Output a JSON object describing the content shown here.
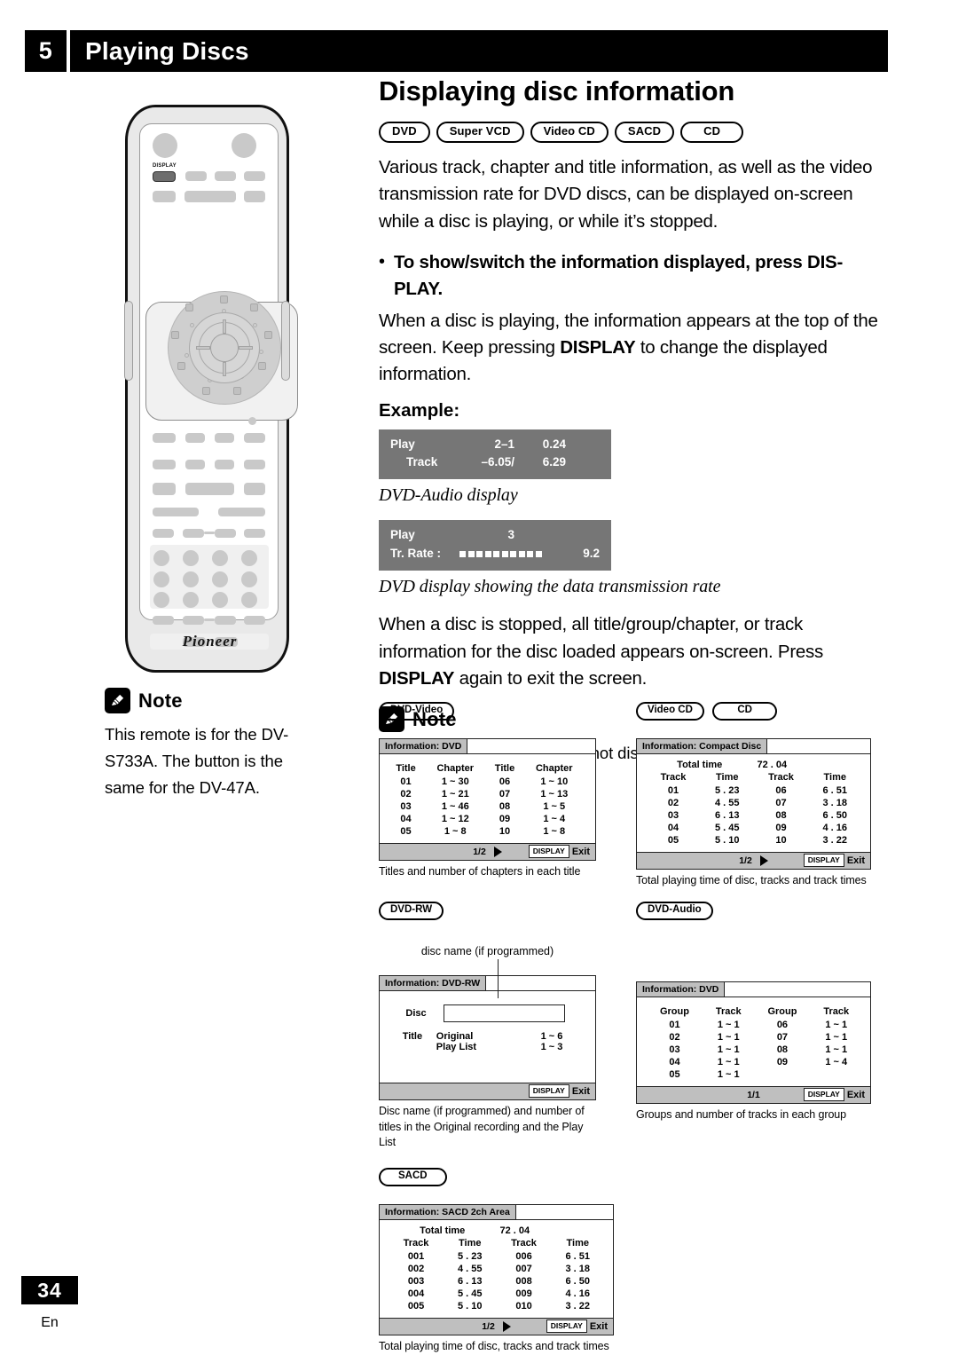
{
  "header": {
    "chapter_number": "5",
    "chapter_title": "Playing Discs"
  },
  "page": {
    "number": "34",
    "language": "En"
  },
  "remote": {
    "display_button_label": "DISPLAY",
    "brand": "Pioneer"
  },
  "left_note": {
    "title": "Note",
    "text": "This remote is for the DV-S733A. The button is the same for the DV-47A."
  },
  "main": {
    "title": "Displaying disc information",
    "badges": [
      "DVD",
      "Super VCD",
      "Video CD",
      "SACD",
      "CD"
    ],
    "intro": "Various track, chapter and title information, as well as the video transmission rate for DVD discs, can be displayed on-screen while a disc is playing, or while it’s stopped.",
    "bullet_1": "To show/switch the information displayed, press DIS-PLAY.",
    "para_2_a": "When a disc is playing, the information appears at the top of the screen. Keep pressing ",
    "para_2_bold": "DISPLAY",
    "para_2_b": " to change the displayed information.",
    "example_label": "Example:",
    "para_3_a": "When a disc is stopped, all title/group/chapter, or track information for the disc loaded appears on-screen. Press ",
    "para_3_bold": "DISPLAY",
    "para_3_b": " again to exit the screen."
  },
  "osd_examples": [
    {
      "row1": {
        "label": "Play",
        "col2": "2–1",
        "col3": "0.24"
      },
      "row2": {
        "label": "Track",
        "col2": "–6.05/",
        "col3": "6.29"
      },
      "caption": "DVD-Audio display"
    },
    {
      "row1": {
        "label": "Play",
        "col2": "3",
        "col3": ""
      },
      "row2": {
        "label": "Tr. Rate :",
        "bars": 10,
        "col3": "9.2"
      },
      "caption": "DVD display showing the data transmission rate"
    }
  ],
  "right_note": {
    "title": "Note",
    "text": "Information for Super VCD is not displayed."
  },
  "diagrams": {
    "dvd_video": {
      "badge": "DVD-Video",
      "tab": "Information: DVD",
      "headers": [
        "Title",
        "Chapter",
        "Title",
        "Chapter"
      ],
      "rows": [
        [
          "01",
          "1 ~ 30",
          "06",
          "1 ~ 10"
        ],
        [
          "02",
          "1 ~ 21",
          "07",
          "1 ~ 13"
        ],
        [
          "03",
          "1 ~ 46",
          "08",
          "1 ~ 5"
        ],
        [
          "04",
          "1 ~ 12",
          "09",
          "1 ~ 4"
        ],
        [
          "05",
          "1 ~ 8",
          "10",
          "1 ~ 8"
        ]
      ],
      "page_indicator": "1/2",
      "btn_display": "DISPLAY",
      "btn_exit": "Exit",
      "caption": "Titles and number of chapters in each title"
    },
    "compact_disc": {
      "badges": [
        "Video CD",
        "CD"
      ],
      "tab": "Information: Compact Disc",
      "total_time_label": "Total time",
      "total_time_value": "72 . 04",
      "headers": [
        "Track",
        "Time",
        "Track",
        "Time"
      ],
      "rows": [
        [
          "01",
          "5 . 23",
          "06",
          "6 . 51"
        ],
        [
          "02",
          "4 . 55",
          "07",
          "3 . 18"
        ],
        [
          "03",
          "6 . 13",
          "08",
          "6 . 50"
        ],
        [
          "04",
          "5 . 45",
          "09",
          "4 . 16"
        ],
        [
          "05",
          "5 . 10",
          "10",
          "3 . 22"
        ]
      ],
      "page_indicator": "1/2",
      "btn_display": "DISPLAY",
      "btn_exit": "Exit",
      "caption": "Total playing time of disc, tracks and track times"
    },
    "dvd_rw": {
      "badge": "DVD-RW",
      "pointer_label": "disc name (if programmed)",
      "tab": "Information: DVD-RW",
      "disc_label": "Disc",
      "disc_value": "",
      "title_label": "Title",
      "rows": [
        [
          "Original",
          "1 ~ 6"
        ],
        [
          "Play List",
          "1 ~ 3"
        ]
      ],
      "btn_display": "DISPLAY",
      "btn_exit": "Exit",
      "caption": "Disc name (if programmed) and number of titles in the Original recording and the Play List"
    },
    "dvd_audio": {
      "badge": "DVD-Audio",
      "tab": "Information: DVD",
      "headers": [
        "Group",
        "Track",
        "Group",
        "Track"
      ],
      "rows": [
        [
          "01",
          "1 ~ 1",
          "06",
          "1 ~ 1"
        ],
        [
          "02",
          "1 ~ 1",
          "07",
          "1 ~ 1"
        ],
        [
          "03",
          "1 ~ 1",
          "08",
          "1 ~ 1"
        ],
        [
          "04",
          "1 ~ 1",
          "09",
          "1 ~ 4"
        ],
        [
          "05",
          "1 ~ 1",
          "",
          ""
        ]
      ],
      "page_indicator": "1/1",
      "btn_display": "DISPLAY",
      "btn_exit": "Exit",
      "caption": "Groups and number of tracks in each group"
    },
    "sacd": {
      "badge": "SACD",
      "tab": "Information: SACD 2ch Area",
      "total_time_label": "Total time",
      "total_time_value": "72 . 04",
      "headers": [
        "Track",
        "Time",
        "Track",
        "Time"
      ],
      "rows": [
        [
          "001",
          "5 . 23",
          "006",
          "6 . 51"
        ],
        [
          "002",
          "4 . 55",
          "007",
          "3 . 18"
        ],
        [
          "003",
          "6 . 13",
          "008",
          "6 . 50"
        ],
        [
          "004",
          "5 . 45",
          "009",
          "4 . 16"
        ],
        [
          "005",
          "5 . 10",
          "010",
          "3 . 22"
        ]
      ],
      "page_indicator": "1/2",
      "btn_display": "DISPLAY",
      "btn_exit": "Exit",
      "caption": "Total playing time of disc, tracks and track times"
    }
  }
}
